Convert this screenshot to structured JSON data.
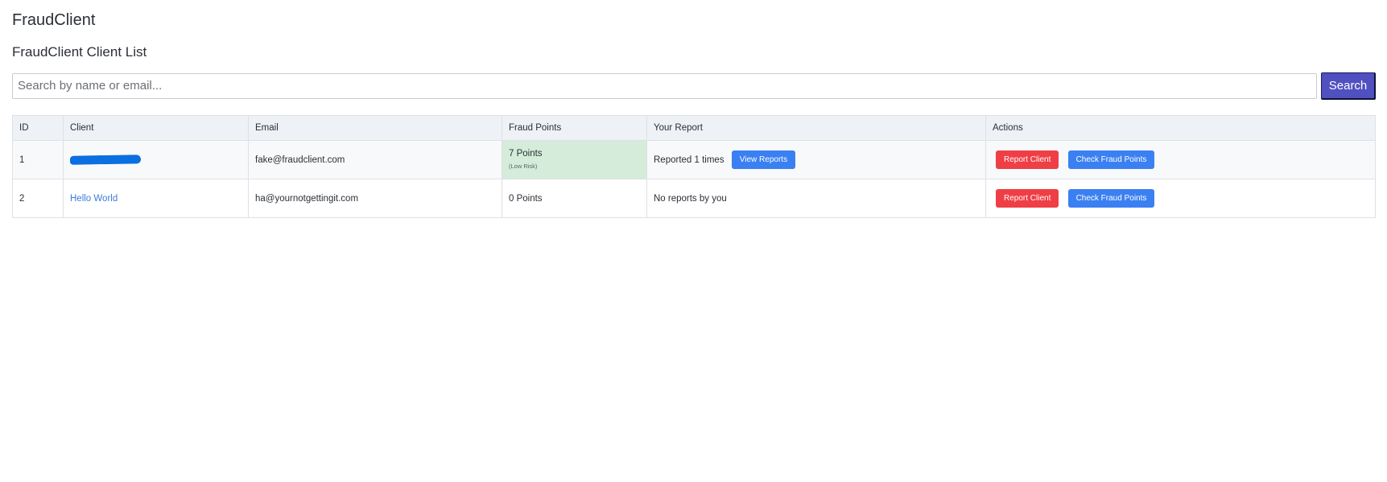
{
  "app": {
    "title": "FraudClient"
  },
  "page": {
    "heading": "FraudClient Client List"
  },
  "search": {
    "placeholder": "Search by name or email...",
    "value": "",
    "button_label": "Search"
  },
  "table": {
    "headers": [
      "ID",
      "Client",
      "Email",
      "Fraud Points",
      "Your Report",
      "Actions"
    ],
    "rows": [
      {
        "id": "1",
        "client": "",
        "client_redacted": true,
        "email": "fake@fraudclient.com",
        "fraud_points": "7 Points",
        "risk_label": "(Low Risk)",
        "report_text": "Reported 1 times",
        "view_reports_label": "View Reports",
        "report_button_label": "Report Client",
        "check_button_label": "Check Fraud Points"
      },
      {
        "id": "2",
        "client": "Hello World",
        "client_redacted": false,
        "email": "ha@yournotgettingit.com",
        "fraud_points": "0 Points",
        "risk_label": "",
        "report_text": "No reports by you",
        "view_reports_label": "",
        "report_button_label": "Report Client",
        "check_button_label": "Check Fraud Points"
      }
    ]
  },
  "colors": {
    "search_button": "#5150c0",
    "report_button": "#ef3e45",
    "check_button": "#3a80f2",
    "low_risk_cell": "#d4ecd9",
    "link": "#3b7bd9"
  }
}
